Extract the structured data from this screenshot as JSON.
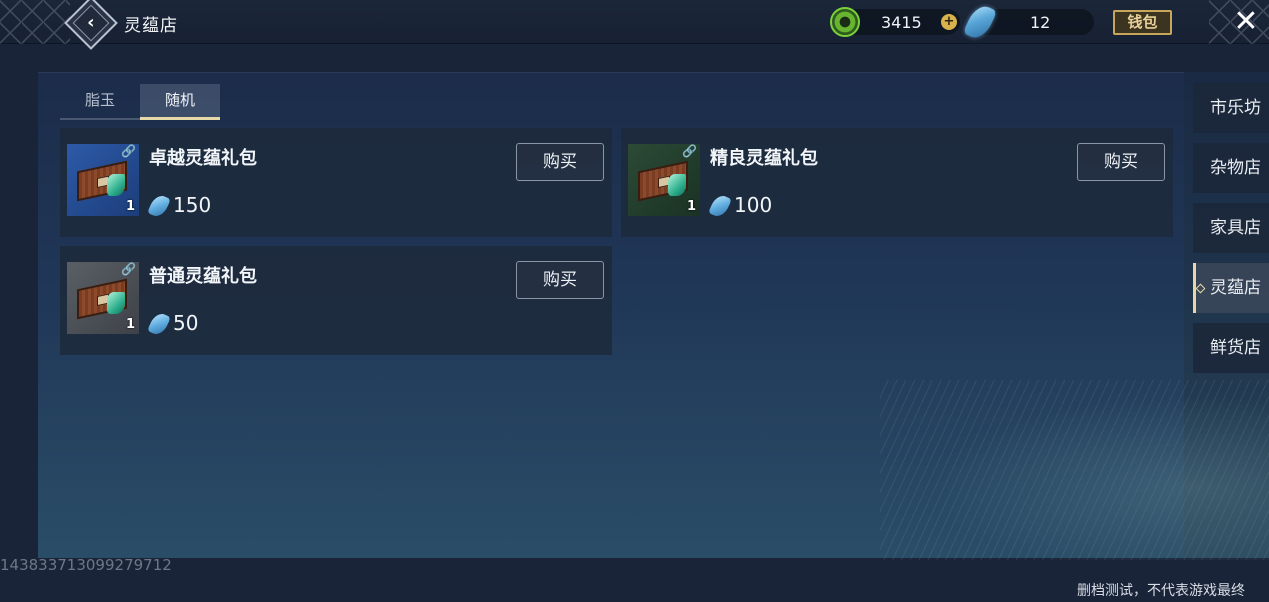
{
  "header": {
    "title": "灵蕴店",
    "currency_green": {
      "value": "3415",
      "icon": "green-coin-icon"
    },
    "currency_crystal": {
      "value": "12",
      "icon": "blue-crystal-icon"
    },
    "wallet_label": "钱包"
  },
  "tabs": [
    {
      "label": "脂玉",
      "active": false
    },
    {
      "label": "随机",
      "active": true
    }
  ],
  "items": [
    {
      "name": "卓越灵蕴礼包",
      "count": "1",
      "price": "150",
      "frame": "blue",
      "buy_label": "购买"
    },
    {
      "name": "精良灵蕴礼包",
      "count": "1",
      "price": "100",
      "frame": "green",
      "buy_label": "购买"
    },
    {
      "name": "普通灵蕴礼包",
      "count": "1",
      "price": "50",
      "frame": "gray",
      "buy_label": "购买"
    }
  ],
  "side_nav": [
    {
      "label": "市乐坊",
      "active": false
    },
    {
      "label": "杂物店",
      "active": false
    },
    {
      "label": "家具店",
      "active": false
    },
    {
      "label": "灵蕴店",
      "active": true
    },
    {
      "label": "鲜货店",
      "active": false
    }
  ],
  "footer": {
    "uid": "143833713099279712",
    "note": "删档测试，不代表游戏最终"
  },
  "colors": {
    "accent_gold": "#e4d9a6",
    "background": "#1a2438",
    "card": "#1e2a3c"
  }
}
